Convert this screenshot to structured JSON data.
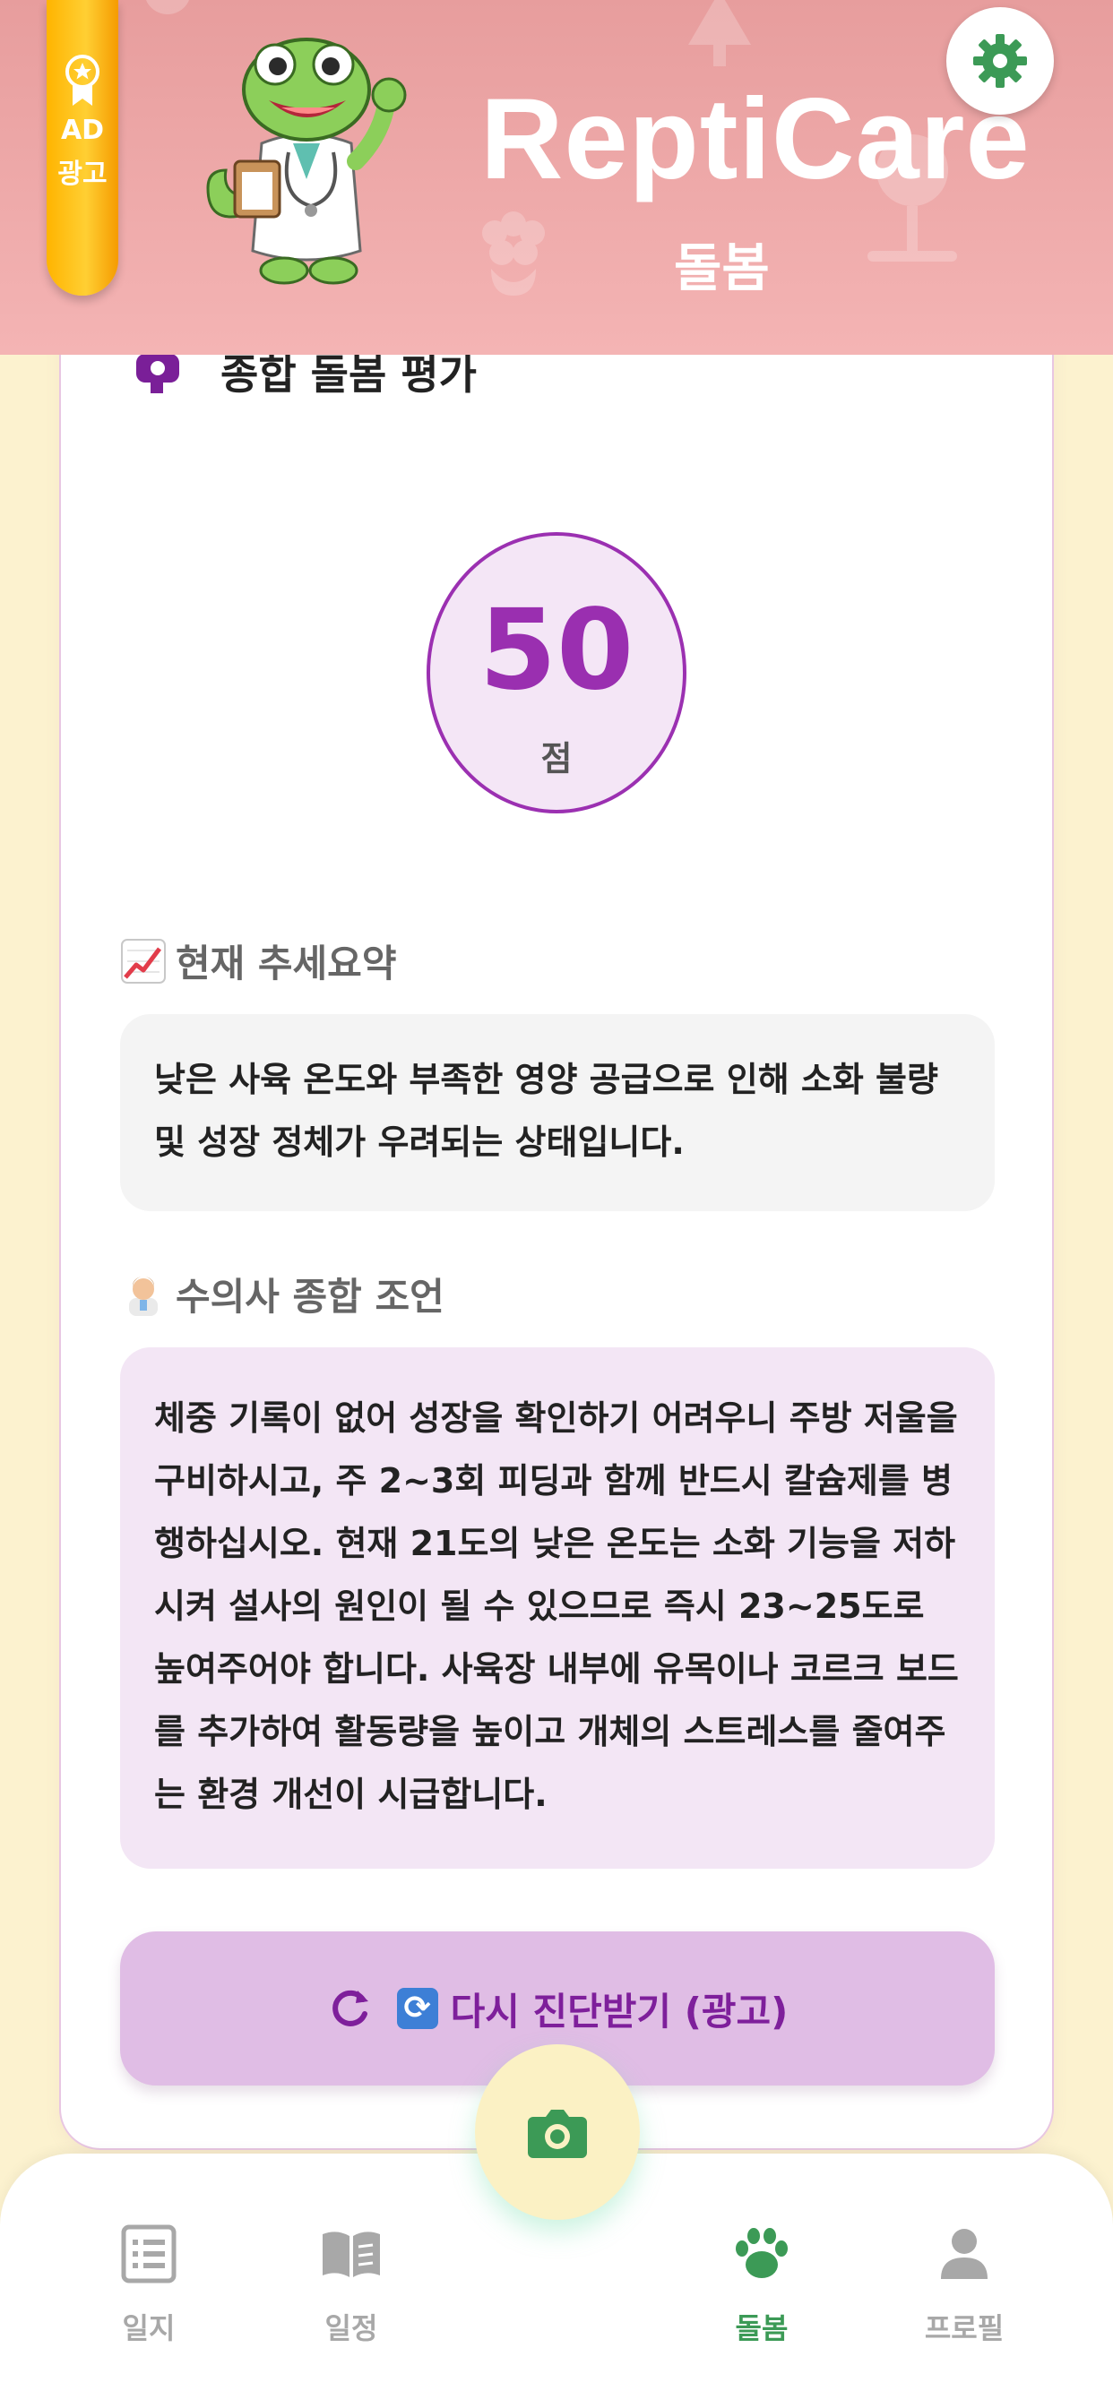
{
  "header": {
    "app_title": "ReptiCare",
    "app_subtitle": "돌봄",
    "ad_badge": {
      "line1": "AD",
      "line2": "광고"
    }
  },
  "card": {
    "section_title": "종합 돌봄 평가",
    "score": {
      "value": "50",
      "unit": "점"
    },
    "trend": {
      "heading": "현재 추세요약",
      "text": "낮은 사육 온도와 부족한 영양 공급으로 인해 소화 불량 및 성장 정체가 우려되는 상태입니다."
    },
    "advice": {
      "heading": "수의사 종합 조언",
      "text": "체중 기록이 없어 성장을 확인하기 어려우니 주방 저울을 구비하시고, 주 2~3회 피딩과 함께 반드시 칼슘제를 병행하십시오. 현재 21도의 낮은 온도는 소화 기능을 저하시켜 설사의 원인이 될 수 있으므로 즉시 23~25도로 높여주어야 합니다. 사육장 내부에 유목이나 코르크 보드를 추가하여 활동량을 높이고 개체의 스트레스를 줄여주는 환경 개선이 시급합니다."
    },
    "retry_button": "다시 진단받기 (광고)"
  },
  "bottom_nav": {
    "items": [
      {
        "label": "일지",
        "icon": "list-icon"
      },
      {
        "label": "일정",
        "icon": "book-icon"
      },
      {
        "label": "돌봄",
        "icon": "paw-icon",
        "active": true
      },
      {
        "label": "프로필",
        "icon": "person-icon"
      }
    ],
    "fab_icon": "camera-icon"
  },
  "colors": {
    "header_bg": "#e79d9d",
    "app_bg": "#fcf2cf",
    "accent_purple": "#9a2fb0",
    "nav_active": "#3c9a56",
    "gear": "#3c9a56"
  }
}
